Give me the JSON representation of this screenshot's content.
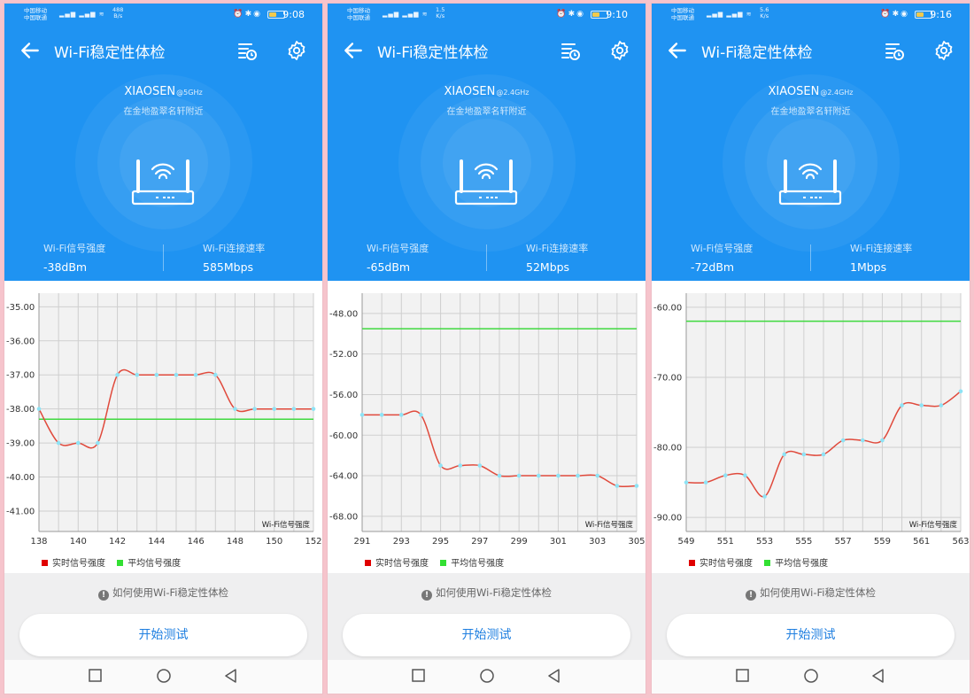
{
  "app": {
    "title": "Wi-Fi稳定性体检",
    "location": "在金地盈翠名轩附近",
    "metric_signal_label": "Wi-Fi信号强度",
    "metric_speed_label": "Wi-Fi连接速率",
    "legend_realtime": "实时信号强度",
    "legend_average": "平均信号强度",
    "help_text": "如何使用Wi-Fi稳定性体检",
    "start_button": "开始测试",
    "chart_corner_label": "Wi-Fi信号强度"
  },
  "colors": {
    "brand_blue": "#1f93f2",
    "realtime_line": "#e04a3c",
    "average_line": "#3fd93f",
    "point": "#8ee3f5"
  },
  "phones": [
    {
      "status": {
        "carrier1": "中国移动",
        "carrier2": "中国联通",
        "rate_value": "488",
        "rate_unit": "B/s",
        "time": "9:08",
        "battery": "20",
        "battery_level": 0.2
      },
      "ssid": "XIAOSEN",
      "band": "@5GHz",
      "signal": "-38dBm",
      "speed": "585Mbps"
    },
    {
      "status": {
        "carrier1": "中国移动",
        "carrier2": "中国联通",
        "rate_value": "1.5",
        "rate_unit": "K/s",
        "time": "9:10",
        "battery": "20",
        "battery_level": 0.2
      },
      "ssid": "XIAOSEN",
      "band": "@2.4GHz",
      "signal": "-65dBm",
      "speed": "52Mbps"
    },
    {
      "status": {
        "carrier1": "中国移动",
        "carrier2": "中国联通",
        "rate_value": "5.6",
        "rate_unit": "K/s",
        "time": "9:16",
        "battery": "19",
        "battery_level": 0.19
      },
      "ssid": "XIAOSEN",
      "band": "@2.4GHz",
      "signal": "-72dBm",
      "speed": "1Mbps"
    }
  ],
  "chart_data": [
    {
      "type": "line",
      "x": [
        138,
        139,
        140,
        141,
        142,
        143,
        144,
        145,
        146,
        147,
        148,
        149,
        150,
        151,
        152
      ],
      "series": [
        {
          "name": "实时信号强度",
          "values": [
            -38,
            -39,
            -39,
            -39,
            -37,
            -37,
            -37,
            -37,
            -37,
            -37,
            -38,
            -38,
            -38,
            -38,
            -38
          ]
        },
        {
          "name": "平均信号强度",
          "values": [
            -38.3,
            -38.3,
            -38.3,
            -38.3,
            -38.3,
            -38.3,
            -38.3,
            -38.3,
            -38.3,
            -38.3,
            -38.3,
            -38.3,
            -38.3,
            -38.3,
            -38.3
          ]
        }
      ],
      "xticks": [
        138,
        140,
        142,
        144,
        146,
        148,
        150,
        152
      ],
      "yticks": [
        -35,
        -36,
        -37,
        -38,
        -39,
        -40,
        -41
      ],
      "ylim": [
        -41.6,
        -34.6
      ],
      "xlim": [
        138,
        152
      ],
      "annotation": "Wi-Fi信号强度"
    },
    {
      "type": "line",
      "x": [
        291,
        292,
        293,
        294,
        295,
        296,
        297,
        298,
        299,
        300,
        301,
        302,
        303,
        304,
        305
      ],
      "series": [
        {
          "name": "实时信号强度",
          "values": [
            -58,
            -58,
            -58,
            -58,
            -63,
            -63,
            -63,
            -64,
            -64,
            -64,
            -64,
            -64,
            -64,
            -65,
            -65
          ]
        },
        {
          "name": "平均信号强度",
          "values": [
            -49.5,
            -49.5,
            -49.5,
            -49.5,
            -49.5,
            -49.5,
            -49.5,
            -49.5,
            -49.5,
            -49.5,
            -49.5,
            -49.5,
            -49.5,
            -49.5,
            -49.5
          ]
        }
      ],
      "xticks": [
        291,
        293,
        295,
        297,
        299,
        301,
        303,
        305
      ],
      "yticks": [
        -48,
        -52,
        -56,
        -60,
        -64,
        -68
      ],
      "ylim": [
        -69.5,
        -46
      ],
      "xlim": [
        291,
        305
      ],
      "annotation": "Wi-Fi信号强度"
    },
    {
      "type": "line",
      "x": [
        549,
        550,
        551,
        552,
        553,
        554,
        555,
        556,
        557,
        558,
        559,
        560,
        561,
        562,
        563
      ],
      "series": [
        {
          "name": "实时信号强度",
          "values": [
            -85,
            -85,
            -84,
            -84,
            -87,
            -81,
            -81,
            -81,
            -79,
            -79,
            -79,
            -74,
            -74,
            -74,
            -72
          ]
        },
        {
          "name": "平均信号强度",
          "values": [
            -62,
            -62,
            -62,
            -62,
            -62,
            -62,
            -62,
            -62,
            -62,
            -62,
            -62,
            -62,
            -62,
            -62,
            -62
          ]
        }
      ],
      "xticks": [
        549,
        551,
        553,
        555,
        557,
        559,
        561,
        563
      ],
      "yticks": [
        -60,
        -70,
        -80,
        -90
      ],
      "ylim": [
        -92,
        -58
      ],
      "xlim": [
        549,
        563
      ],
      "annotation": "Wi-Fi信号强度"
    }
  ]
}
